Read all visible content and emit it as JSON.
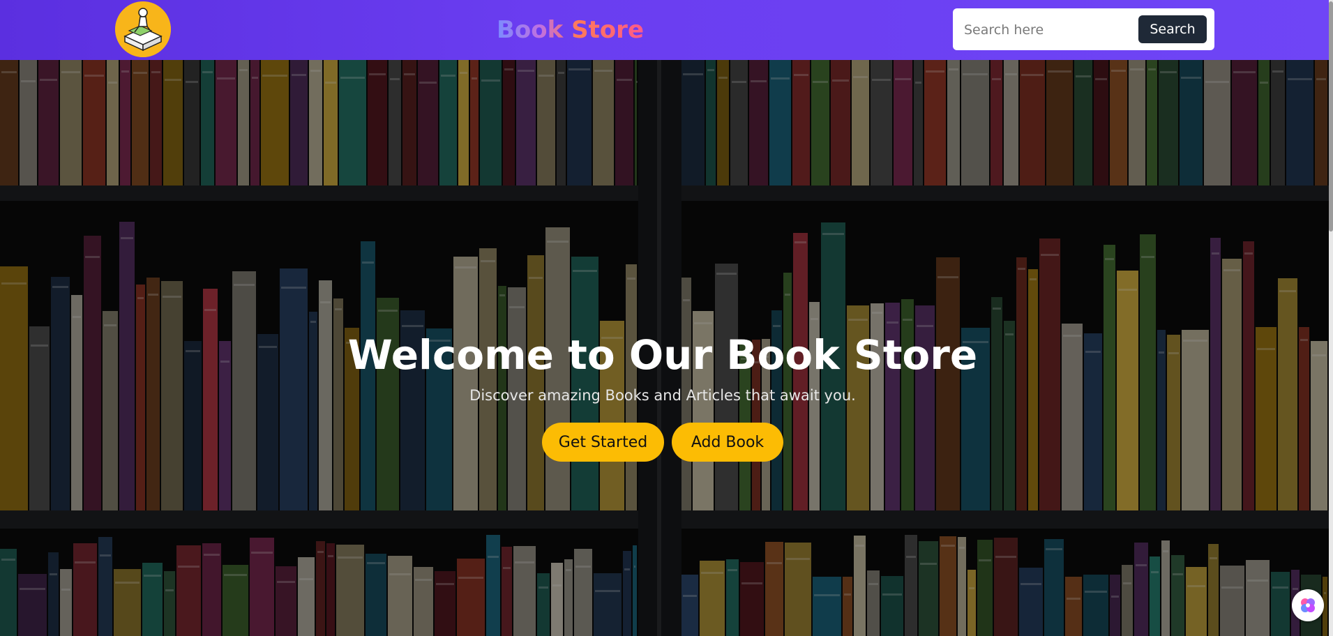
{
  "navbar": {
    "logo_name": "bookstore-logo",
    "brand": "Book Store",
    "search": {
      "placeholder": "Search here",
      "value": "",
      "button_label": "Search"
    }
  },
  "hero": {
    "title": "Welcome to Our Book Store",
    "subtitle": "Discover amazing Books and Articles that await you.",
    "buttons": [
      {
        "label": "Get Started"
      },
      {
        "label": "Add Book"
      }
    ]
  },
  "theme": {
    "navbar_gradient": [
      "#5b2fe0",
      "#6f45f6"
    ],
    "accent_yellow": "#fcbc04",
    "search_button": "#1f2937"
  },
  "floating": {
    "icon": "assistant-icon"
  }
}
